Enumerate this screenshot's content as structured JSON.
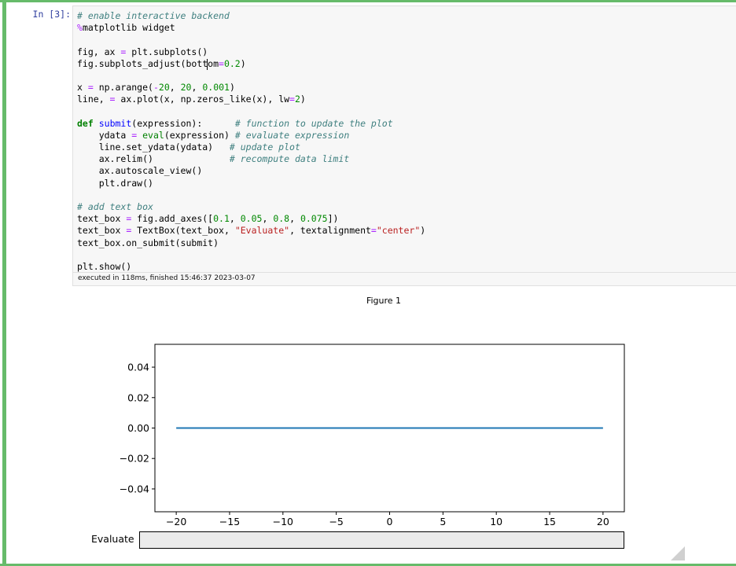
{
  "notebook": {
    "prompt": "In [3]:",
    "code_lines": [
      [
        [
          "# enable interactive backend",
          "cm"
        ]
      ],
      [
        [
          "%",
          "magic"
        ],
        [
          "matplotlib widget",
          ""
        ]
      ],
      [],
      [
        [
          "fig, ax ",
          ""
        ],
        [
          "=",
          "op"
        ],
        [
          " plt.subplots()",
          ""
        ]
      ],
      [
        [
          "fig.subplots_adjust(bottom",
          ""
        ],
        [
          "=",
          "op"
        ],
        [
          "0.2",
          "num"
        ],
        [
          ")",
          ""
        ]
      ],
      [],
      [
        [
          "x ",
          ""
        ],
        [
          "=",
          "op"
        ],
        [
          " np.arange(",
          ""
        ],
        [
          "-",
          "op"
        ],
        [
          "20",
          "num"
        ],
        [
          ", ",
          ""
        ],
        [
          "20",
          "num"
        ],
        [
          ", ",
          ""
        ],
        [
          "0.001",
          "num"
        ],
        [
          ")",
          ""
        ]
      ],
      [
        [
          "line, ",
          ""
        ],
        [
          "=",
          "op"
        ],
        [
          " ax.plot(x, np.zeros_like(x), lw",
          ""
        ],
        [
          "=",
          "op"
        ],
        [
          "2",
          "num"
        ],
        [
          ")",
          ""
        ]
      ],
      [],
      [
        [
          "def",
          "kw"
        ],
        [
          " ",
          ""
        ],
        [
          "submit",
          "fn"
        ],
        [
          "(expression):      ",
          ""
        ],
        [
          "# function to update the plot",
          "cm"
        ]
      ],
      [
        [
          "    ydata ",
          ""
        ],
        [
          "=",
          "op"
        ],
        [
          " ",
          ""
        ],
        [
          "eval",
          "bi"
        ],
        [
          "(expression) ",
          ""
        ],
        [
          "# evaluate expression",
          "cm"
        ]
      ],
      [
        [
          "    line.set_ydata(ydata)   ",
          ""
        ],
        [
          "# update plot",
          "cm"
        ]
      ],
      [
        [
          "    ax.relim()              ",
          ""
        ],
        [
          "# recompute data limit",
          "cm"
        ]
      ],
      [
        [
          "    ax.autoscale_view()",
          ""
        ]
      ],
      [
        [
          "    plt.draw()",
          ""
        ]
      ],
      [],
      [
        [
          "# add text box",
          "cm"
        ]
      ],
      [
        [
          "text_box ",
          ""
        ],
        [
          "=",
          "op"
        ],
        [
          " fig.add_axes([",
          ""
        ],
        [
          "0.1",
          "num"
        ],
        [
          ", ",
          ""
        ],
        [
          "0.05",
          "num"
        ],
        [
          ", ",
          ""
        ],
        [
          "0.8",
          "num"
        ],
        [
          ", ",
          ""
        ],
        [
          "0.075",
          "num"
        ],
        [
          "])",
          ""
        ]
      ],
      [
        [
          "text_box ",
          ""
        ],
        [
          "=",
          "op"
        ],
        [
          " TextBox(text_box, ",
          ""
        ],
        [
          "\"Evaluate\"",
          "str"
        ],
        [
          ", textalignment",
          ""
        ],
        [
          "=",
          "op"
        ],
        [
          "\"center\"",
          "str"
        ],
        [
          ")",
          ""
        ]
      ],
      [
        [
          "text_box.on_submit(submit)",
          ""
        ]
      ],
      [],
      [
        [
          "plt.show()",
          ""
        ]
      ]
    ],
    "exec_status": "executed in 118ms, finished 15:46:37 2023-03-07"
  },
  "figure": {
    "title": "Figure 1",
    "textbox_label": "Evaluate",
    "textbox_value": ""
  },
  "chart_data": {
    "type": "line",
    "series": [
      {
        "x": [
          -20,
          20
        ],
        "y": [
          0,
          0
        ],
        "color": "#1f77b4"
      }
    ],
    "xlim": [
      -22,
      22
    ],
    "ylim": [
      -0.055,
      0.055
    ],
    "xticks": [
      -20,
      -15,
      -10,
      -5,
      0,
      5,
      10,
      15,
      20
    ],
    "yticks": [
      0.04,
      0.02,
      0.0,
      -0.02,
      -0.04
    ],
    "xtick_labels": [
      "−20",
      "−15",
      "−10",
      "−5",
      "0",
      "5",
      "10",
      "15",
      "20"
    ],
    "ytick_labels": [
      "0.04",
      "0.02",
      "0.00",
      "−0.02",
      "−0.04"
    ],
    "grid": false
  }
}
